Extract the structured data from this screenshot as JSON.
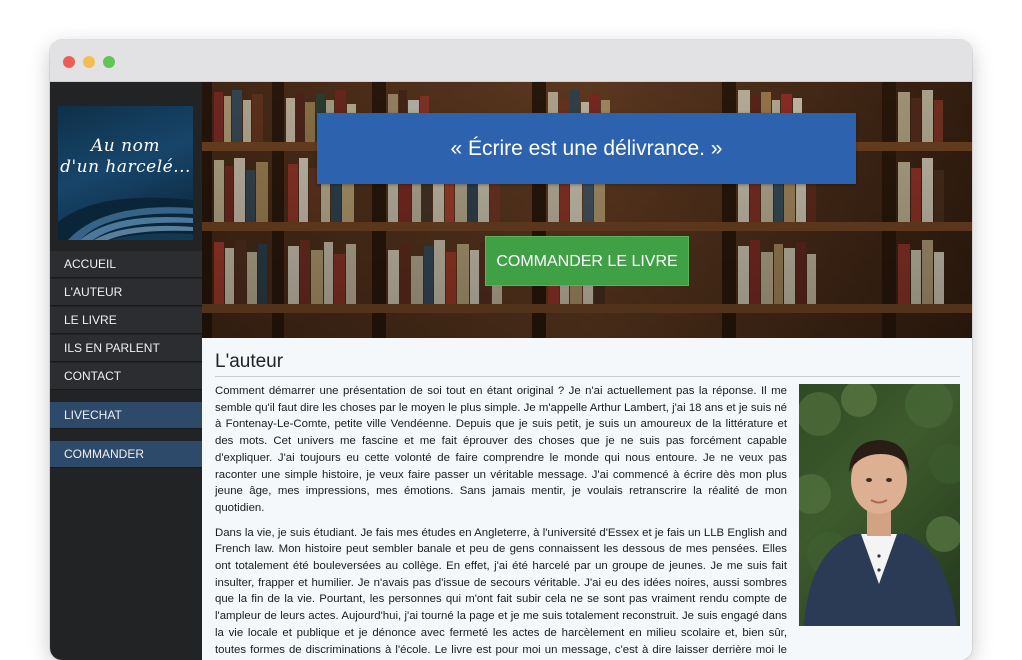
{
  "window": {
    "controls": [
      "close",
      "minimize",
      "maximize"
    ]
  },
  "sidebar": {
    "logo": {
      "line1": "Au nom",
      "line2": "d'un harcelé..."
    },
    "nav": [
      {
        "label": "ACCUEIL"
      },
      {
        "label": "L'AUTEUR"
      },
      {
        "label": "LE LIVRE"
      },
      {
        "label": "ILS EN PARLENT"
      },
      {
        "label": "CONTACT"
      }
    ],
    "livechat": "LIVECHAT",
    "commander": "COMMANDER"
  },
  "hero": {
    "quote": "« Écrire est une délivrance. »",
    "button": "COMMANDER LE LIVRE"
  },
  "article": {
    "title": "L'auteur",
    "paragraphs": [
      "Comment démarrer une présentation de soi tout en étant original ? Je n'ai actuellement pas la réponse. Il me semble qu'il faut dire les choses par le moyen le plus simple. Je m'appelle Arthur Lambert, j'ai 18 ans et je suis né à Fontenay-Le-Comte, petite ville Vendéenne. Depuis que je suis petit, je suis un amoureux de la littérature et des mots. Cet univers me fascine et me fait éprouver des choses que je ne suis pas forcément capable d'expliquer. J'ai toujours eu cette volonté de faire comprendre le monde qui nous entoure. Je ne veux pas raconter une simple histoire, je veux faire passer un véritable message. J'ai commencé à écrire dès mon plus jeune âge, mes impressions, mes émotions. Sans jamais mentir, je voulais retranscrire la réalité de mon quotidien.",
      "Dans la vie, je suis étudiant. Je fais mes études en Angleterre, à l'université d'Essex et je fais un LLB English and French law. Mon histoire peut sembler banale et peu de gens connaissent les dessous de mes pensées. Elles ont totalement été bouleversées au collège. En effet, j'ai été harcelé par un groupe de jeunes. Je me suis fait insulter, frapper et humilier. Je n'avais pas d'issue de secours véritable. J'ai eu des idées noires, aussi sombres que la fin de la vie. Pourtant, les personnes qui m'ont fait subir cela ne se sont pas vraiment rendu compte de l'ampleur de leurs actes. Aujourd'hui, j'ai tourné la page et je me suis totalement reconstruit. Je suis engagé dans la vie locale et publique et je dénonce avec fermeté les actes de harcèlement en milieu scolaire et, bien sûr, toutes formes de discriminations à l'école. Le livre est pour moi un message, c'est à dire laisser derrière moi le passé, tout en mettant"
    ]
  }
}
